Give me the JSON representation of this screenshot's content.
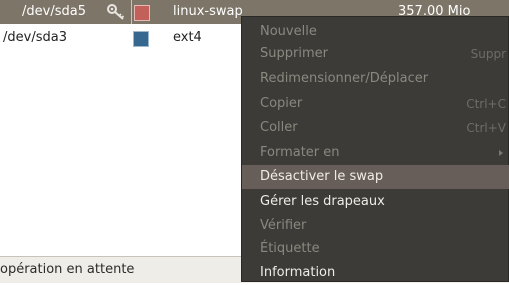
{
  "partitions": [
    {
      "device": "/dev/sda5",
      "filesystem": "linux-swap",
      "size": "357.00 Mio",
      "fs_color": "#c2605a",
      "mounted_icon": "key-icon"
    },
    {
      "device": "/dev/sda3",
      "filesystem": "ext4",
      "size": "",
      "fs_color": "#35678f"
    }
  ],
  "status": {
    "text": "opération en attente"
  },
  "context_menu": {
    "items": [
      {
        "label": "Nouvelle",
        "shortcut": "",
        "enabled": false
      },
      {
        "label": "Supprimer",
        "shortcut": "Suppr",
        "enabled": false
      },
      {
        "label": "Redimensionner/Déplacer",
        "shortcut": "",
        "enabled": false
      },
      {
        "label": "Copier",
        "shortcut": "Ctrl+C",
        "enabled": false
      },
      {
        "label": "Coller",
        "shortcut": "Ctrl+V",
        "enabled": false
      },
      {
        "label": "Formater en",
        "shortcut": "",
        "enabled": false,
        "submenu": true
      },
      {
        "label": "Désactiver le swap",
        "shortcut": "",
        "enabled": true,
        "highlighted": true
      },
      {
        "label": "Gérer les drapeaux",
        "shortcut": "",
        "enabled": true
      },
      {
        "label": "Vérifier",
        "shortcut": "",
        "enabled": false
      },
      {
        "label": "Étiquette",
        "shortcut": "",
        "enabled": false
      },
      {
        "label": "Information",
        "shortcut": "",
        "enabled": true
      }
    ]
  },
  "colors": {
    "selection": "#7c7568",
    "menu_bg": "#3c3b37",
    "menu_highlight": "#685e59"
  }
}
